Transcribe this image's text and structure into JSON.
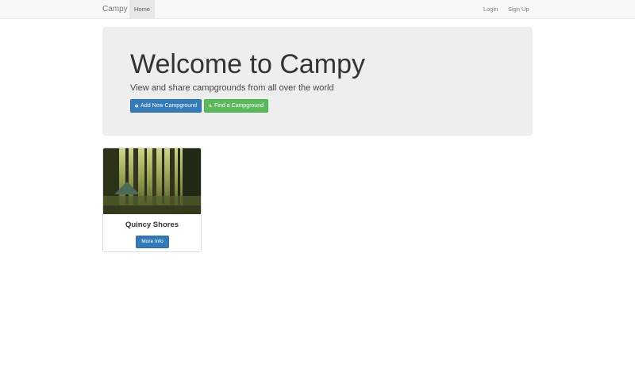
{
  "navbar": {
    "brand": "Campy",
    "home_label": "Home",
    "login_label": "Login",
    "signup_label": "Sign Up"
  },
  "hero": {
    "title": "Welcome to Campy",
    "subtitle": "View and share campgrounds from all over the world",
    "add_button": {
      "label": "Add New Campground",
      "icon": "plus-circle-icon"
    },
    "find_button": {
      "label": "Find a Campground",
      "icon": "search-icon"
    }
  },
  "campgrounds": [
    {
      "name": "Quincy Shores",
      "button_label": "More Info"
    }
  ],
  "colors": {
    "primary": "#337ab7",
    "success": "#5cb85c",
    "jumbotron_bg": "#eeeeee",
    "navbar_bg": "#f8f8f8"
  }
}
